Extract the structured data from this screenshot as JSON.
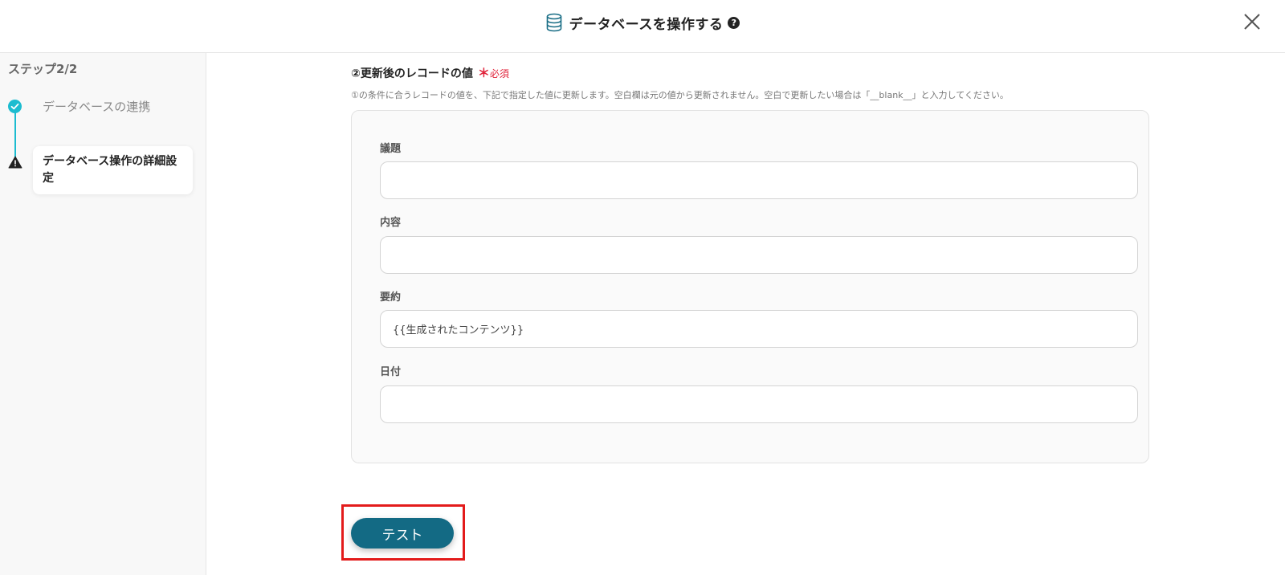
{
  "header": {
    "title": "データベースを操作する",
    "icon": "database-icon",
    "help_icon": "question-circle-icon",
    "help_symbol": "?",
    "close_icon": "close-icon"
  },
  "sidebar": {
    "step_indicator": "ステップ2/2",
    "steps": [
      {
        "label": "データベースの連携",
        "status": "completed",
        "icon": "check-circle-icon"
      },
      {
        "label": "データベース操作の詳細設定",
        "status": "warning",
        "icon": "warning-triangle-icon"
      }
    ]
  },
  "main": {
    "section_title": "②更新後のレコードの値",
    "required_mark": "＊",
    "required_label": "必須",
    "description": "①の条件に合うレコードの値を、下記で指定した値に更新します。空白欄は元の値から更新されません。空白で更新したい場合は「__blank__」と入力してください。",
    "fields": [
      {
        "label": "議題",
        "value": ""
      },
      {
        "label": "内容",
        "value": ""
      },
      {
        "label": "要約",
        "value": "{{生成されたコンテンツ}}"
      },
      {
        "label": "日付",
        "value": ""
      }
    ],
    "test_button": "テスト"
  },
  "colors": {
    "accent": "#1cbcd0",
    "primary_button": "#136a84",
    "required": "#e0233a",
    "highlight_box": "#e31b1b"
  }
}
